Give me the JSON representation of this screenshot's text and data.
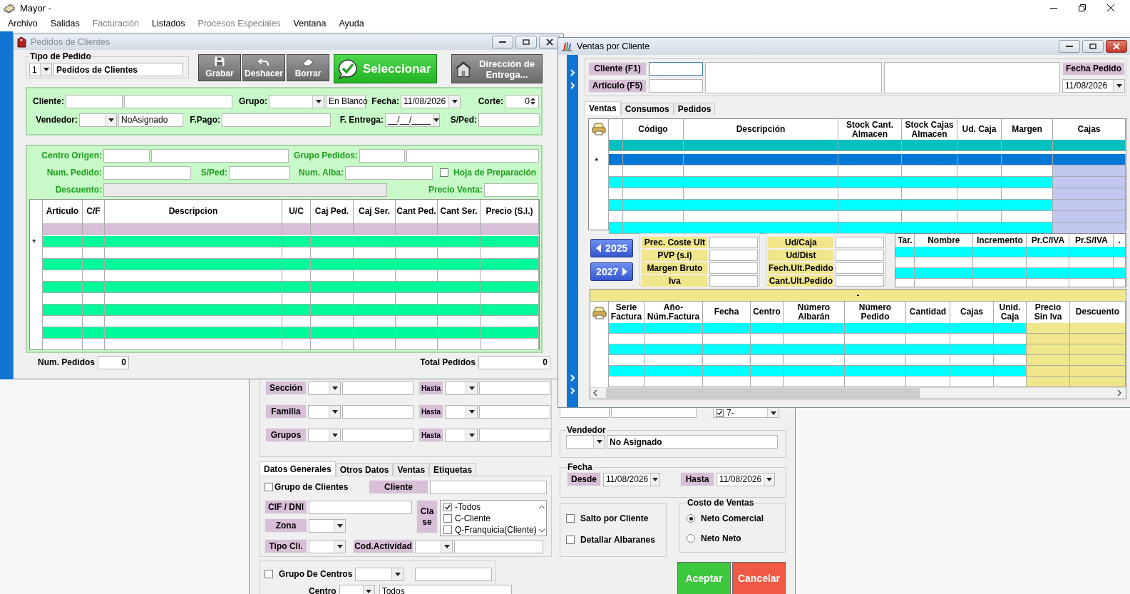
{
  "app": {
    "title": "Mayor -",
    "menu": [
      {
        "label": "Archivo",
        "disabled": false
      },
      {
        "label": "Salidas",
        "disabled": false
      },
      {
        "label": "Facturación",
        "disabled": true
      },
      {
        "label": "Listados",
        "disabled": false
      },
      {
        "label": "Procesos Especiales",
        "disabled": true
      },
      {
        "label": "Ventana",
        "disabled": false
      },
      {
        "label": "Ayuda",
        "disabled": false
      }
    ]
  },
  "pedidos_window": {
    "title": "Pedidos de Clientes",
    "active": false,
    "tipo_pedido": {
      "title": "Tipo de Pedido",
      "code": "1",
      "value": "Pedidos de Clientes"
    },
    "toolbar": [
      {
        "label": "Grabar",
        "kind": "disk"
      },
      {
        "label": "Deshacer",
        "kind": "undo"
      },
      {
        "label": "Borrar",
        "kind": "eraser"
      }
    ],
    "select_button": "Seleccionar",
    "address_button": "Dirección de Entrega...",
    "header": {
      "cliente_label": "Cliente:",
      "grupo_label": "Grupo:",
      "grupo_desc": "En Blanco",
      "fecha_label": "Fecha:",
      "fecha": "11/08/2026",
      "corte_label": "Corte:",
      "corte": "0",
      "vendedor_label": "Vendedor:",
      "vendedor_desc": "NoAsignado",
      "fpago_label": "F.Pago:",
      "fentrega_label": "F. Entrega:",
      "fentrega": "__/__/____",
      "sped_label": "S/Ped:"
    },
    "filters": {
      "centro_origen_label": "Centro Origen:",
      "grupo_pedidos_label": "Grupo Pedidos:",
      "num_pedido_label": "Num. Pedido:",
      "sped_label": "S/Ped:",
      "num_alba_label": "Num. Alba:",
      "hoja": {
        "label": "Hoja de Preparación",
        "checked": false
      },
      "descuento_label": "Descuento:",
      "precio_venta_label": "Precio Venta:"
    },
    "grid": {
      "columns": [
        "Articulo",
        "C/F",
        "Descripcion",
        "U/C",
        "Caj Ped.",
        "Caj Ser.",
        "Cant Ped.",
        "Cant Ser.",
        "Precio (S.I.)"
      ],
      "new_row_marker": "*"
    },
    "footer": {
      "num_pedidos_label": "Num. Pedidos",
      "num_pedidos": "0",
      "total_label": "Total Pedidos",
      "total": "0"
    }
  },
  "ventas_window": {
    "title": "Ventas por Cliente",
    "active": true,
    "cliente_label": "Cliente (F1)",
    "articulo_label": "Artículo (F5)",
    "fecha_pedido_label": "Fecha Pedido",
    "fecha_pedido": "11/08/2026",
    "tabs": [
      {
        "label": "Ventas",
        "selected": true
      },
      {
        "label": "Consumos",
        "selected": false
      },
      {
        "label": "Pedidos",
        "selected": false
      }
    ],
    "grid": {
      "columns": [
        "Código",
        "Descripción",
        "Stock Cant.\nAlmacen",
        "Stock Cajas\nAlmacen",
        "Ud. Caja",
        "Margen",
        "Cajas"
      ],
      "new_row_marker": "*"
    },
    "prev_year": "2025",
    "next_year": "2027",
    "info_labels": [
      "Prec. Coste Ult",
      "PVP (s.i)",
      "Margen Bruto",
      "Iva"
    ],
    "info_labels_2": [
      "Ud/Caja",
      "Ud/Dist",
      "Fech.Ult.Pedido",
      "Cant.Ult.Pedido"
    ],
    "tarifas": {
      "columns": [
        "Tar.",
        "Nombre",
        "Incremento",
        "Pr.C/IVA",
        "Pr.S/IVA",
        "."
      ]
    },
    "detail": {
      "title": "-",
      "columns": [
        "Serie\nFactura",
        "Año-\nNúm.Factura",
        "Fecha",
        "Centro",
        "Número\nAlbarán",
        "Número\nPedido",
        "Cantidad",
        "Cajas",
        "Unid.\nCaja",
        "Precio\nSin Iva",
        "Descuento"
      ]
    }
  },
  "criteria_window": {
    "ranges": [
      {
        "label": "Sección",
        "to_label": "Hasta"
      },
      {
        "label": "Familia",
        "to_label": "Hasta"
      },
      {
        "label": "Grupos",
        "to_label": "Hasta"
      }
    ],
    "tabs": [
      {
        "label": "Datos Generales",
        "selected": true
      },
      {
        "label": "Otros Datos",
        "selected": false
      },
      {
        "label": "Ventas",
        "selected": false
      },
      {
        "label": "Etiquetas",
        "selected": false
      }
    ],
    "grupo_clientes": {
      "label": "Grupo de Clientes",
      "checked": false
    },
    "cliente_label": "Cliente",
    "cif_label": "CIF / DNI",
    "zona_label": "Zona",
    "tipo_cli_label": "Tipo Cli.",
    "cod_actividad_label": "Cod.Actividad",
    "clase_label": "Cla\nse",
    "clase_options": [
      {
        "label": "-Todos",
        "checked": true
      },
      {
        "label": "C-Cliente",
        "checked": false
      },
      {
        "label": "Q-Franquicia(Cliente)",
        "checked": false
      }
    ],
    "grupo_centros": {
      "label": "Grupo De Centros",
      "checked": false
    },
    "centro_label": "Centro",
    "centro_value": "Todos",
    "partial_combo": {
      "label": "7-",
      "checked": true
    },
    "vendedor": {
      "title": "Vendedor",
      "value": "No Asignado"
    },
    "fecha": {
      "title": "Fecha",
      "desde_label": "Desde",
      "desde": "11/08/2026",
      "hasta_label": "Hasta",
      "hasta": "11/08/2026"
    },
    "options": [
      {
        "label": "Salto por Cliente",
        "checked": false
      },
      {
        "label": "Detallar Albaranes",
        "checked": false
      }
    ],
    "costo": {
      "title": "Costo de Ventas",
      "options": [
        {
          "label": "Neto Comercial",
          "selected": true
        },
        {
          "label": "Neto Neto",
          "selected": false
        }
      ]
    },
    "accept_button": "Aceptar",
    "cancel_button": "Cancelar"
  }
}
